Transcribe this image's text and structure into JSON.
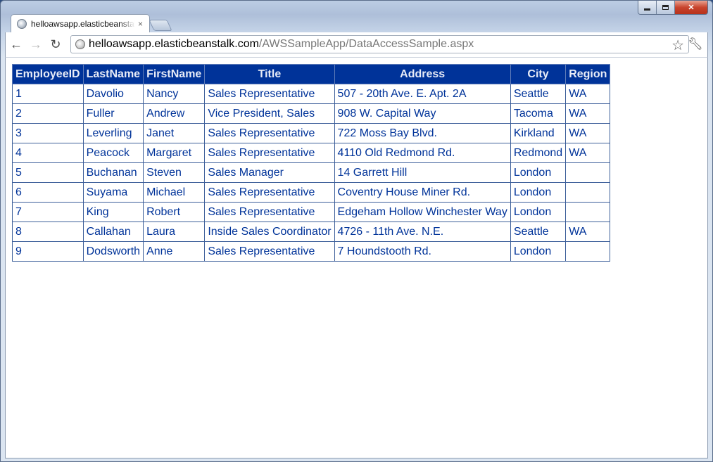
{
  "browser": {
    "tab_title": "helloawsapp.elasticbeanstalk.com/AWSSampleApp/DataAccessSample.aspx",
    "tab_close": "×",
    "url_host": "helloawsapp.elasticbeanstalk.com",
    "url_path": "/AWSSampleApp/DataAccessSample.aspx",
    "icons": {
      "back": "back-arrow-icon",
      "forward": "forward-arrow-icon",
      "reload": "reload-icon",
      "bookmark": "star-icon",
      "menu": "wrench-icon"
    }
  },
  "table": {
    "headers": [
      "EmployeeID",
      "LastName",
      "FirstName",
      "Title",
      "Address",
      "City",
      "Region"
    ],
    "rows": [
      [
        "1",
        "Davolio",
        "Nancy",
        "Sales Representative",
        "507 - 20th Ave. E. Apt. 2A",
        "Seattle",
        "WA"
      ],
      [
        "2",
        "Fuller",
        "Andrew",
        "Vice President, Sales",
        "908 W. Capital Way",
        "Tacoma",
        "WA"
      ],
      [
        "3",
        "Leverling",
        "Janet",
        "Sales Representative",
        "722 Moss Bay Blvd.",
        "Kirkland",
        "WA"
      ],
      [
        "4",
        "Peacock",
        "Margaret",
        "Sales Representative",
        "4110 Old Redmond Rd.",
        "Redmond",
        "WA"
      ],
      [
        "5",
        "Buchanan",
        "Steven",
        "Sales Manager",
        "14 Garrett Hill",
        "London",
        ""
      ],
      [
        "6",
        "Suyama",
        "Michael",
        "Sales Representative",
        "Coventry House Miner Rd.",
        "London",
        ""
      ],
      [
        "7",
        "King",
        "Robert",
        "Sales Representative",
        "Edgeham Hollow Winchester Way",
        "London",
        ""
      ],
      [
        "8",
        "Callahan",
        "Laura",
        "Inside Sales Coordinator",
        "4726 - 11th Ave. N.E.",
        "Seattle",
        "WA"
      ],
      [
        "9",
        "Dodsworth",
        "Anne",
        "Sales Representative",
        "7 Houndstooth Rd.",
        "London",
        ""
      ]
    ]
  },
  "colors": {
    "header_bg": "#003399",
    "header_text": "#e8ecf7",
    "cell_text": "#003399"
  }
}
